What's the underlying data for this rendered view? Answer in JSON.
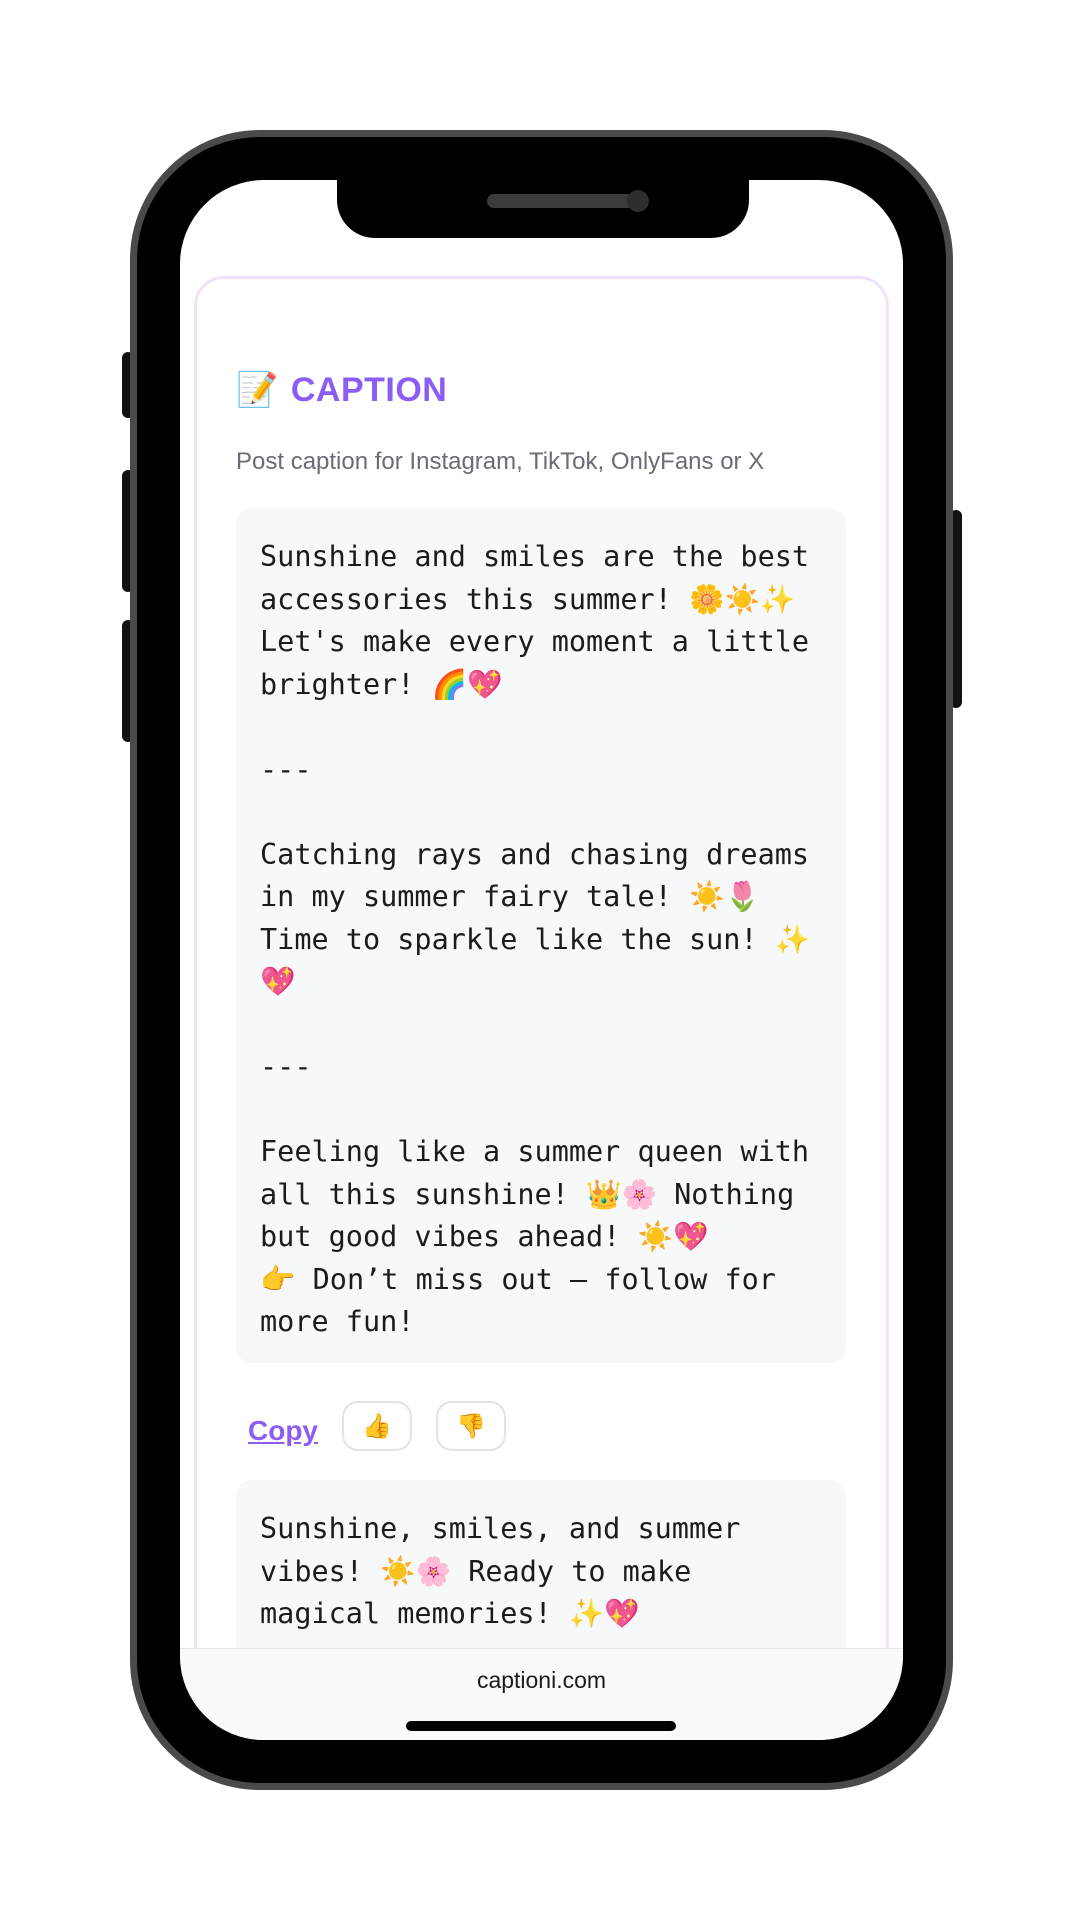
{
  "header": {
    "title_emoji": "📝",
    "title": "CAPTION",
    "subtitle": "Post caption for Instagram, TikTok, OnlyFans or X"
  },
  "captions": [
    {
      "text": "Sunshine and smiles are the best accessories this summer! 🌼☀️✨ Let's make every moment a little brighter! 🌈💖\n\n---\n\nCatching rays and chasing dreams in my summer fairy tale! ☀️🌷 Time to sparkle like the sun! ✨💖\n\n---\n\nFeeling like a summer queen with all this sunshine! 👑🌸 Nothing but good vibes ahead! ☀️💖\n👉 Don’t miss out — follow for more fun!"
    },
    {
      "text": "Sunshine, smiles, and summer vibes! ☀️🌸 Ready to make magical memories! ✨💖"
    }
  ],
  "actions": {
    "copy_label": "Copy",
    "thumbs_up": "👍",
    "thumbs_down": "👎"
  },
  "footer": {
    "url": "captioni.com"
  },
  "colors": {
    "accent": "#8b5cf6",
    "card_border": "#f0e2fb",
    "caption_bg": "#f7f8fa"
  }
}
